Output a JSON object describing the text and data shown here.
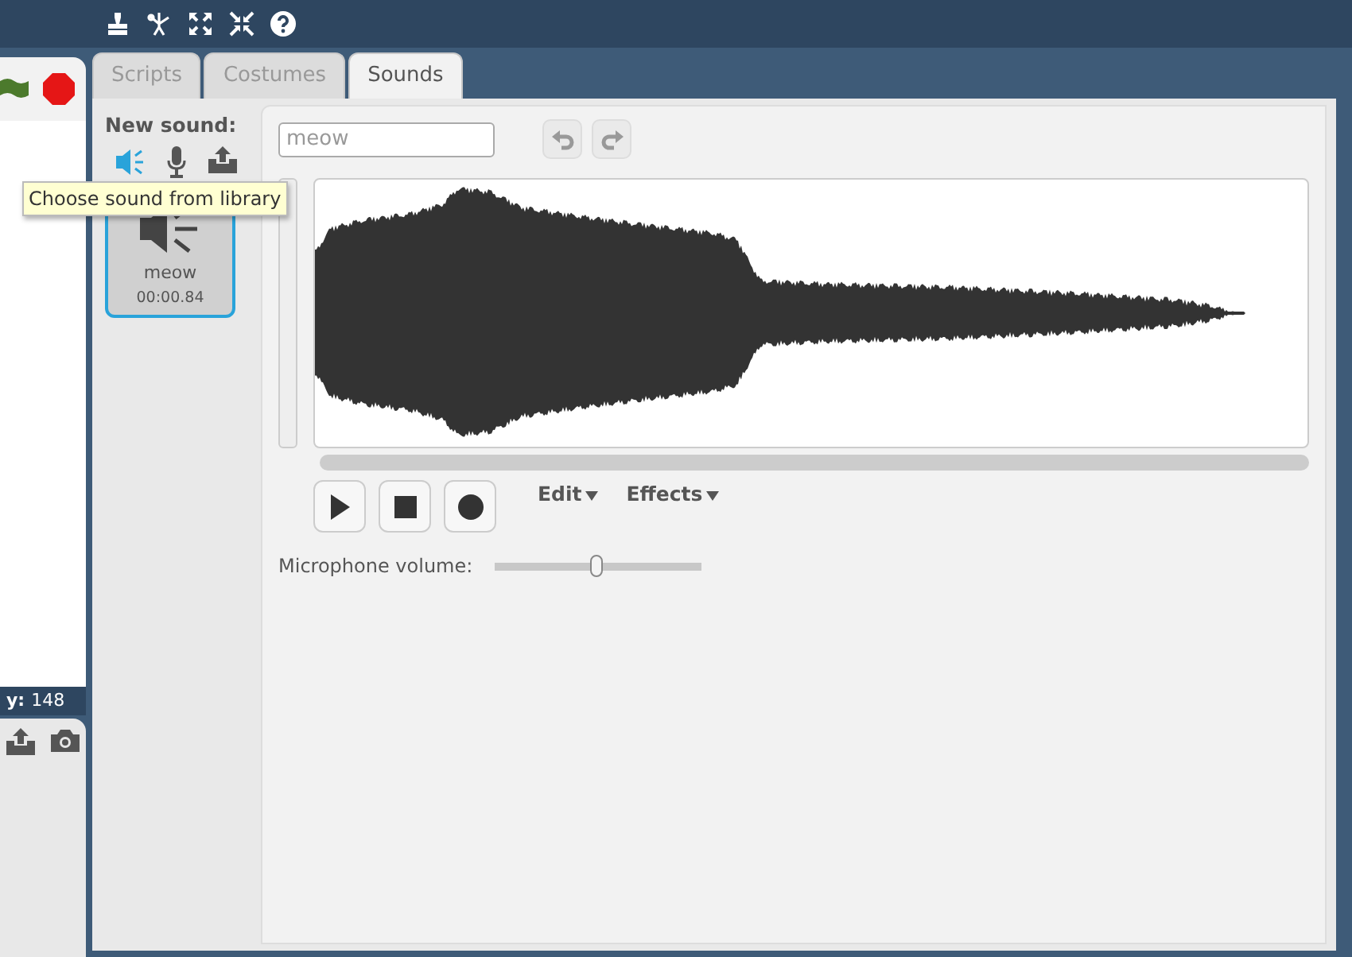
{
  "stage": {
    "y_label": "y:",
    "y_value": "148"
  },
  "tabs": [
    {
      "label": "Scripts",
      "selected": false
    },
    {
      "label": "Costumes",
      "selected": false
    },
    {
      "label": "Sounds",
      "selected": true
    }
  ],
  "new_sound": {
    "label": "New sound:",
    "tooltip": "Choose sound from library"
  },
  "sounds": [
    {
      "name": "meow",
      "duration": "00:00.84",
      "selected": true
    }
  ],
  "editor": {
    "name_field": {
      "value": "meow"
    },
    "menus": [
      "Edit",
      "Effects"
    ],
    "microphone": {
      "label": "Microphone volume:",
      "level": 0.49
    }
  }
}
